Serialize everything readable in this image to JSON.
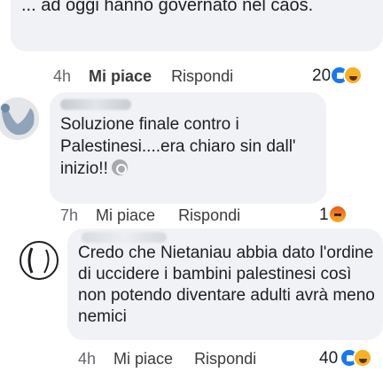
{
  "comment1": {
    "text_tail": "... ad oggi hanno governato nel caos.",
    "time": "4h",
    "like_label": "Mi piace",
    "reply_label": "Rispondi",
    "reaction_count": "20",
    "reactions": [
      "like-icon",
      "haha-icon"
    ]
  },
  "comment2": {
    "author": "",
    "text": "Soluzione finale contro i Palestinesi....era chiaro sin dall' inizio!!",
    "inline_emoji": "sad-icon",
    "time": "7h",
    "like_label": "Mi piace",
    "reply_label": "Rispondi",
    "reaction_count": "1",
    "reactions": [
      "angry-icon"
    ]
  },
  "comment3": {
    "author": "",
    "text": "Credo che Nietaniau abbia dato l'ordine di uccidere i bambini palestinesi così non potendo diventare adulti avrà meno nemici",
    "time": "4h",
    "like_label": "Mi piace",
    "reply_label": "Rispondi",
    "reaction_count": "40",
    "reactions": [
      "like-icon",
      "haha-icon"
    ]
  },
  "colors": {
    "bubble": "#f0f2f5",
    "like_blue": "#1877f2",
    "text": "#1c1e21",
    "meta": "#65676b"
  }
}
